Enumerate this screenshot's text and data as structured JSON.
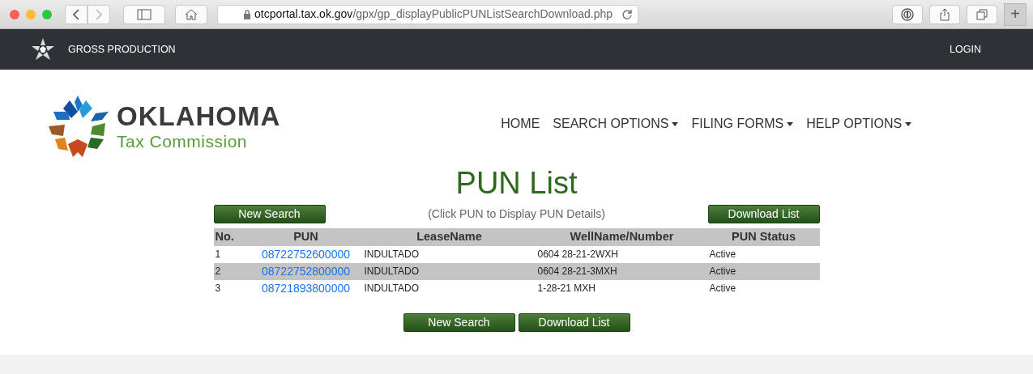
{
  "browser": {
    "url_domain": "otcportal.tax.ok.gov",
    "url_path": "/gpx/gp_displayPublicPUNListSearchDownload.php",
    "new_tab": "+"
  },
  "topbar": {
    "title": "GROSS PRODUCTION",
    "login": "LOGIN"
  },
  "logo": {
    "name": "OKLAHOMA",
    "subtitle": "Tax Commission"
  },
  "menu": [
    {
      "label": "HOME",
      "dropdown": false
    },
    {
      "label": "SEARCH OPTIONS",
      "dropdown": true
    },
    {
      "label": "FILING FORMS",
      "dropdown": true
    },
    {
      "label": "HELP OPTIONS",
      "dropdown": true
    }
  ],
  "page_title": "PUN List",
  "hint": "(Click PUN to Display PUN Details)",
  "top_buttons": [
    "New Search",
    "Download List"
  ],
  "table": {
    "columns": [
      "No.",
      "PUN",
      "LeaseName",
      "WellName/Number",
      "PUN Status"
    ],
    "rows": [
      {
        "no": "1",
        "pun": "08722752600000",
        "lease": "INDULTADO",
        "well": "0604 28-21-2WXH",
        "status": "Active"
      },
      {
        "no": "2",
        "pun": "08722752800000",
        "lease": "INDULTADO",
        "well": "0604 28-21-3MXH",
        "status": "Active"
      },
      {
        "no": "3",
        "pun": "08721893800000",
        "lease": "INDULTADO",
        "well": "1-28-21 MXH",
        "status": "Active"
      }
    ]
  },
  "bottom_buttons": [
    "New Search",
    "Download List"
  ]
}
